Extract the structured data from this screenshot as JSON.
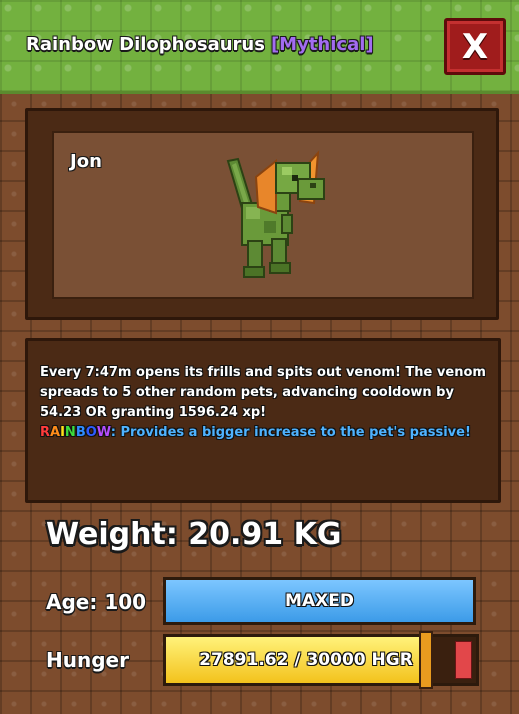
{
  "window": {
    "title_name": "Rainbow Dilophosaurus",
    "title_rarity": "[Mythical]",
    "close_label": "X"
  },
  "pet": {
    "nickname": "Jon",
    "image_icon": "dilophosaurus-pet-icon"
  },
  "description": {
    "main": "Every 7:47m opens its frills and spits out venom! The venom spreads to 5 other random pets, advancing cooldown by 54.23 OR granting 1596.24 xp!",
    "rainbow_letters": [
      "R",
      "A",
      "I",
      "N",
      "B",
      "O",
      "W"
    ],
    "rainbow_colors": [
      "#ff3b3b",
      "#ff8c1a",
      "#ffe01a",
      "#3ddc3d",
      "#2f8cff",
      "#2f5cff",
      "#b44dff"
    ],
    "rainbow_suffix": ":",
    "rainbow_text": "Provides a bigger increase to the pet's passive!"
  },
  "stats": {
    "weight_label": "Weight: 20.91 KG",
    "age_label": "Age: 100",
    "age_bar_text": "MAXED",
    "hunger_label": "Hunger",
    "hunger_text": "27891.62 / 30000 HGR",
    "hunger_value": 27891.62,
    "hunger_max": 30000
  },
  "colors": {
    "title_bar": "#73b13f",
    "rarity": "#a26cf0",
    "close_button": "#a01c1c",
    "age_bar": "#3c9be8",
    "hunger_bar": "#f3c21c",
    "passive_text": "#4fb3ff"
  }
}
